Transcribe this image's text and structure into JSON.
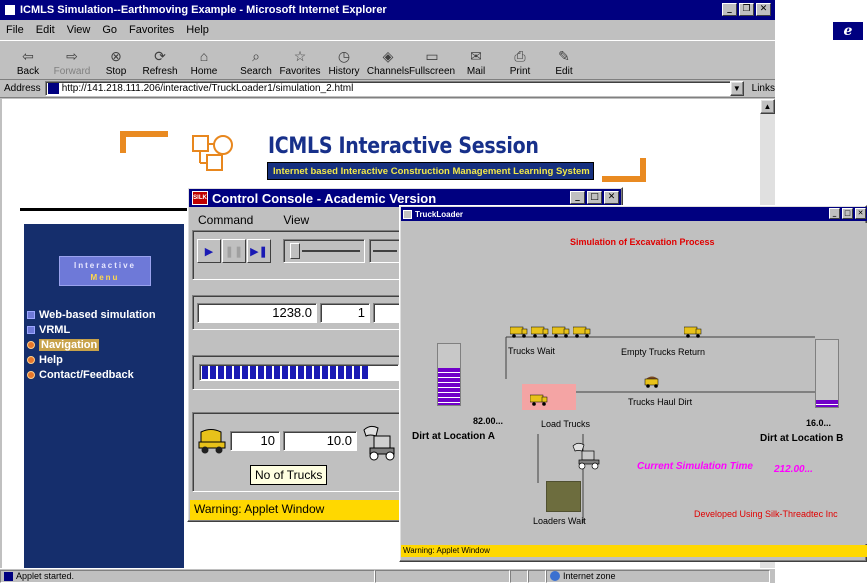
{
  "ie": {
    "title": "ICMLS Simulation--Earthmoving Example - Microsoft Internet Explorer",
    "menu": [
      "File",
      "Edit",
      "View",
      "Go",
      "Favorites",
      "Help"
    ],
    "toolbar": [
      {
        "label": "Back",
        "icon": "⇦"
      },
      {
        "label": "Forward",
        "icon": "⇨",
        "disabled": true
      },
      {
        "label": "Stop",
        "icon": "⊗"
      },
      {
        "label": "Refresh",
        "icon": "⟳"
      },
      {
        "label": "Home",
        "icon": "⌂"
      },
      {
        "label": "Search",
        "icon": "⌕"
      },
      {
        "label": "Favorites",
        "icon": "☆"
      },
      {
        "label": "History",
        "icon": "◷"
      },
      {
        "label": "Channels",
        "icon": "◈"
      },
      {
        "label": "Fullscreen",
        "icon": "▭"
      },
      {
        "label": "Mail",
        "icon": "✉"
      },
      {
        "label": "Print",
        "icon": "⎙"
      },
      {
        "label": "Edit",
        "icon": "✎"
      }
    ],
    "address_label": "Address",
    "address_url": "http://141.218.111.206/interactive/TruckLoader1/simulation_2.html",
    "links_label": "Links",
    "status_text": "Applet started.",
    "zone_text": "Internet zone"
  },
  "page": {
    "banner_title": "ICMLS Interactive Session",
    "banner_subtitle": "Internet based Interactive Construction Management Learning System",
    "menu_header_line1": "Interactive",
    "menu_header_line2": "Menu",
    "nav": [
      {
        "label": "Web-based simulation",
        "bullet": "square"
      },
      {
        "label": "VRML",
        "bullet": "square"
      },
      {
        "label": "Navigation",
        "bullet": "round",
        "highlight": true
      },
      {
        "label": "Help",
        "bullet": "round"
      },
      {
        "label": "Contact/Feedback",
        "bullet": "round"
      }
    ]
  },
  "console": {
    "title": "Control Console - Academic Version",
    "menu": [
      "Command",
      "View"
    ],
    "time_value": "1238.0",
    "count_value": "1",
    "progress_segments": 21,
    "trucks_value": "10",
    "trucks_value2": "10.0",
    "tooltip": "No of Trucks",
    "warning": "Warning: Applet Window"
  },
  "truckloader": {
    "title": "TruckLoader",
    "heading": "Simulation of Excavation Process",
    "trucks_wait": "Trucks Wait",
    "empty_return": "Empty Trucks Return",
    "haul_dirt": "Trucks Haul Dirt",
    "load_trucks": "Load Trucks",
    "loaders_wait": "Loaders Wait",
    "dirt_a_value": "82.00...",
    "dirt_a_label": "Dirt at Location A",
    "dirt_b_value": "16.0...",
    "dirt_b_label": "Dirt at Location B",
    "sim_time_label": "Current Simulation Time",
    "sim_time_value": "212.00...",
    "developed_by": "Developed Using Silk-Threadtec Inc",
    "warning": "Warning: Applet Window",
    "dirt_a_fill": 0.6,
    "dirt_b_fill": 0.1,
    "colors": {
      "heading": "#e00000",
      "sim_time": "#ff00ff",
      "developed": "#e00000",
      "bar_fill": "#7000c8"
    }
  }
}
